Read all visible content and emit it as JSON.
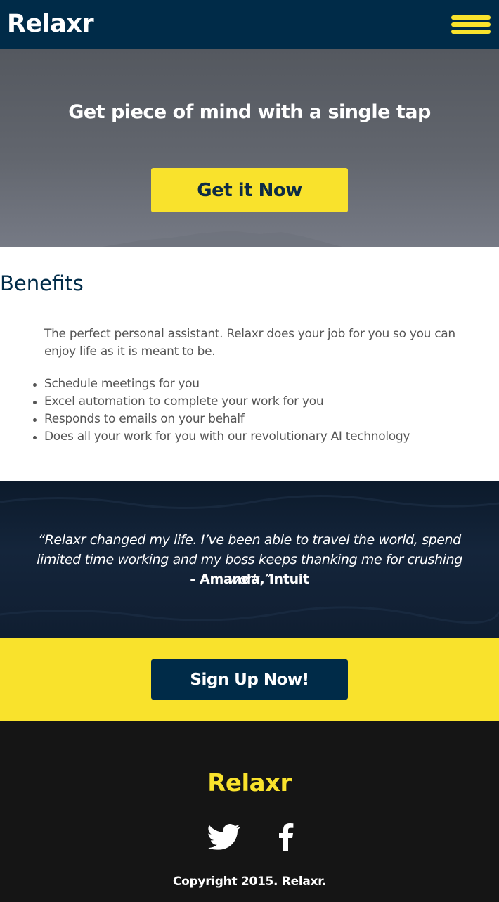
{
  "header": {
    "logo": "Relaxr",
    "menu_icon": "hamburger-menu-icon"
  },
  "hero": {
    "title": "Get piece of mind with a single tap",
    "button_label": "Get it Now"
  },
  "benefits": {
    "title": "Benefits",
    "intro": "The perfect personal assistant. Relaxr does your job for you so you can enjoy life as it is meant to be.",
    "items": [
      "Schedule meetings for you",
      "Excel automation to complete your work for you",
      "Responds to emails on your behalf",
      "Does all your work for you with our revolutionary AI technology"
    ]
  },
  "testimonial": {
    "quote": "“Relaxr changed my life. I’ve been able to travel the world, spend limited time working and my boss keeps thanking me for crushing work.”",
    "author": "- Amanda, Intuit"
  },
  "cta": {
    "button_label": "Sign Up Now!"
  },
  "footer": {
    "logo": "Relaxr",
    "social": [
      "twitter-icon",
      "facebook-icon"
    ],
    "copyright": "Copyright 2015. Relaxr."
  },
  "colors": {
    "brand_navy": "#002b48",
    "accent_yellow": "#f9e22c",
    "footer_bg": "#151515",
    "body_text": "#555555"
  }
}
